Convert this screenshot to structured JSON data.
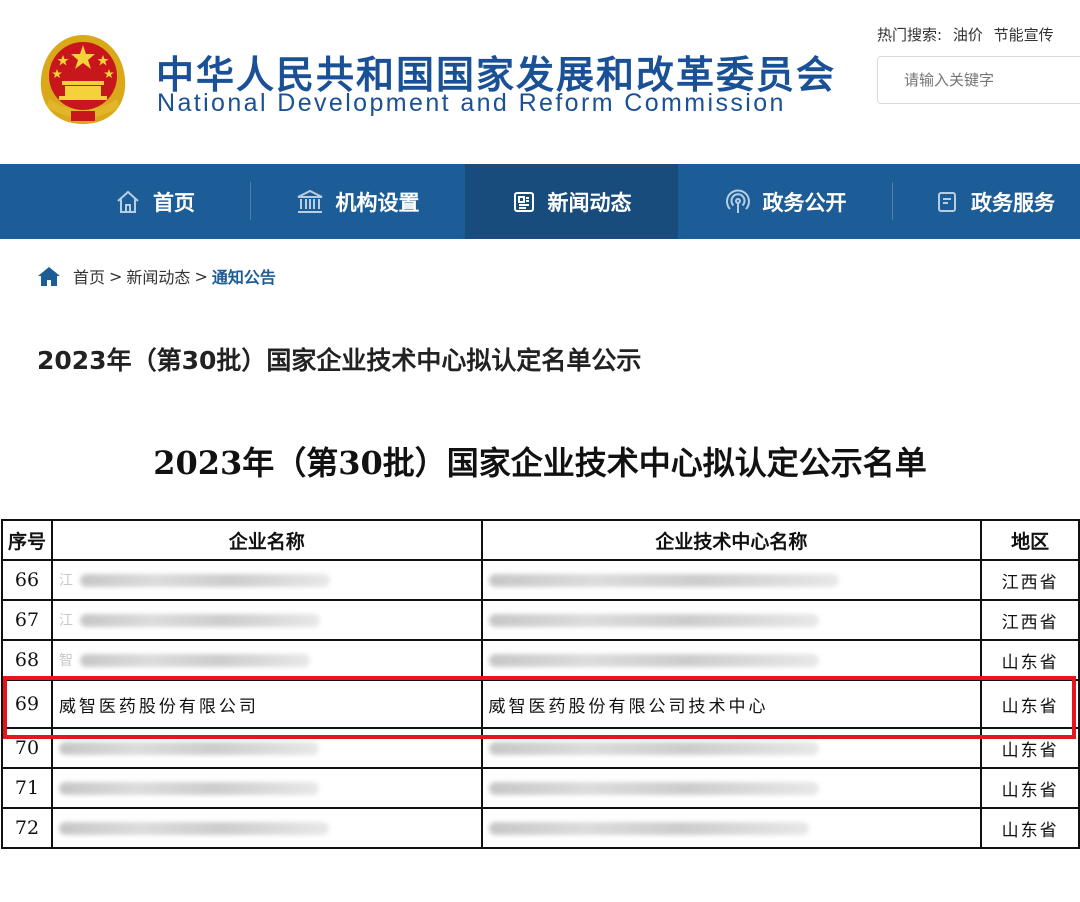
{
  "header": {
    "cn_name": "中华人民共和国国家发展和改革委员会",
    "en_name": "National Development and Reform Commission",
    "hot_search_label": "热门搜索:",
    "hot_search_terms": [
      "油价",
      "节能宣传"
    ],
    "search_placeholder": "请输入关键字"
  },
  "nav": {
    "items": [
      {
        "label": "首页",
        "icon": "home-icon"
      },
      {
        "label": "机构设置",
        "icon": "institution-icon"
      },
      {
        "label": "新闻动态",
        "icon": "news-icon",
        "active": true
      },
      {
        "label": "政务公开",
        "icon": "broadcast-icon"
      },
      {
        "label": "政务服务",
        "icon": "document-icon"
      }
    ]
  },
  "breadcrumb": {
    "items": [
      "首页",
      "新闻动态",
      "通知公告"
    ],
    "separator": ">"
  },
  "article": {
    "title": "2023年（第30批）国家企业技术中心拟认定名单公示",
    "document_title": "2023年（第30批）国家企业技术中心拟认定公示名单"
  },
  "table": {
    "headers": [
      "序号",
      "企业名称",
      "企业技术中心名称",
      "地区"
    ],
    "rows": [
      {
        "num": "66",
        "company": "江",
        "center": "",
        "region": "江西省"
      },
      {
        "num": "67",
        "company": "江",
        "center": "",
        "region": "江西省"
      },
      {
        "num": "68",
        "company": "智",
        "center": "",
        "region": "山东省"
      },
      {
        "num": "69",
        "company": "威智医药股份有限公司",
        "center": "威智医药股份有限公司技术中心",
        "region": "山东省",
        "highlighted": true
      },
      {
        "num": "70",
        "company": "",
        "center": "",
        "region": "山东省"
      },
      {
        "num": "71",
        "company": "",
        "center": "",
        "region": "山东省"
      },
      {
        "num": "72",
        "company": "",
        "center": "",
        "region": "山东省"
      }
    ]
  },
  "colors": {
    "brand_blue": "#1a5196",
    "nav_bg": "#1d5d97",
    "nav_active_bg": "#174c7d",
    "highlight_red": "#e8141a"
  }
}
